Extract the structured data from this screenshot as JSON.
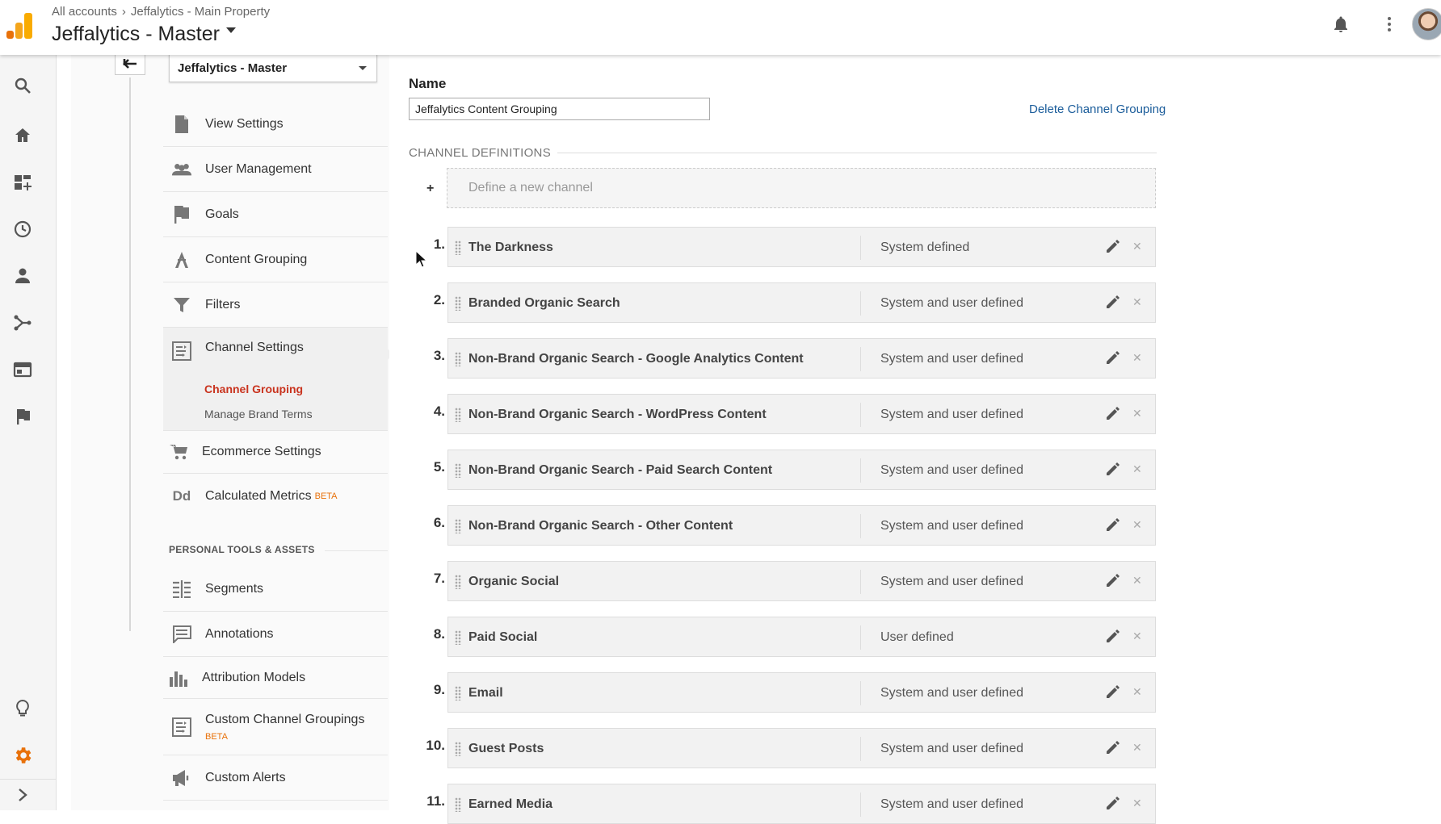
{
  "header": {
    "breadcrumb": [
      "All accounts",
      "Jeffalytics - Main Property"
    ],
    "title": "Jeffalytics - Master"
  },
  "colors": {
    "accent": "#e8710a",
    "link": "#1a5c9a",
    "active_sub": "#c9331e"
  },
  "left_rail": {
    "icons": [
      "search-icon",
      "home-icon",
      "dashboard-icon",
      "clock-icon",
      "person-icon",
      "acquisition-icon",
      "behavior-icon",
      "flag-icon",
      "lightbulb-icon",
      "gear-icon",
      "chevron-right-icon"
    ]
  },
  "admin_nav": {
    "view_select": "Jeffalytics - Master",
    "items": [
      {
        "label": "View Settings",
        "icon": "document-icon"
      },
      {
        "label": "User Management",
        "icon": "users-icon"
      },
      {
        "label": "Goals",
        "icon": "flag-icon"
      },
      {
        "label": "Content Grouping",
        "icon": "person-walk-icon"
      },
      {
        "label": "Filters",
        "icon": "funnel-icon"
      },
      {
        "label": "Channel Settings",
        "icon": "channel-icon"
      }
    ],
    "sub_items": [
      "Channel Grouping",
      "Manage Brand Terms"
    ],
    "items2": [
      {
        "label": "Ecommerce Settings",
        "icon": "cart-icon"
      },
      {
        "label": "Calculated Metrics",
        "icon": "dd-icon",
        "badge": "BETA"
      }
    ],
    "section_title": "PERSONAL TOOLS & ASSETS",
    "items3": [
      {
        "label": "Segments",
        "icon": "segments-icon"
      },
      {
        "label": "Annotations",
        "icon": "comment-icon"
      },
      {
        "label": "Attribution Models",
        "icon": "bar-chart-icon"
      },
      {
        "label": "Custom Channel Groupings",
        "icon": "channel-icon",
        "badge": "BETA"
      },
      {
        "label": "Custom Alerts",
        "icon": "megaphone-icon"
      }
    ]
  },
  "main": {
    "name_label": "Name",
    "name_value": "Jeffalytics Content Grouping",
    "delete_link": "Delete Channel Grouping",
    "definitions_title": "CHANNEL DEFINITIONS",
    "new_channel": "Define a new channel",
    "channels": [
      {
        "num": "1.",
        "name": "The Darkness",
        "type": "System defined"
      },
      {
        "num": "2.",
        "name": "Branded Organic Search",
        "type": "System and user defined"
      },
      {
        "num": "3.",
        "name": "Non-Brand Organic Search - Google Analytics Content",
        "type": "System and user defined"
      },
      {
        "num": "4.",
        "name": "Non-Brand Organic Search - WordPress Content",
        "type": "System and user defined"
      },
      {
        "num": "5.",
        "name": "Non-Brand Organic Search - Paid Search Content",
        "type": "System and user defined"
      },
      {
        "num": "6.",
        "name": "Non-Brand Organic Search - Other Content",
        "type": "System and user defined"
      },
      {
        "num": "7.",
        "name": "Organic Social",
        "type": "System and user defined"
      },
      {
        "num": "8.",
        "name": "Paid Social",
        "type": "User defined"
      },
      {
        "num": "9.",
        "name": "Email",
        "type": "System and user defined"
      },
      {
        "num": "10.",
        "name": "Guest Posts",
        "type": "System and user defined"
      },
      {
        "num": "11.",
        "name": "Earned Media",
        "type": "System and user defined"
      }
    ]
  }
}
